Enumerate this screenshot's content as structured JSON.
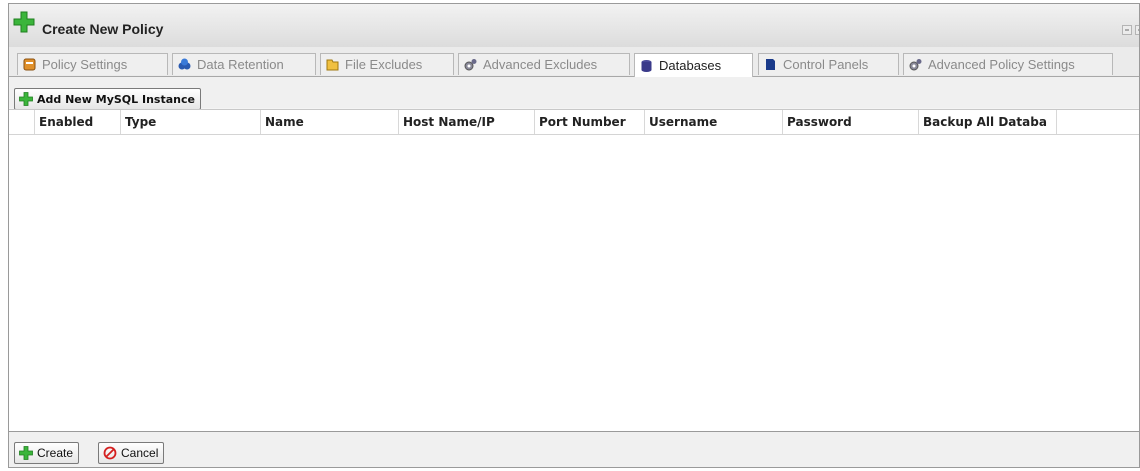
{
  "window": {
    "title": "Create New Policy"
  },
  "tabs": [
    {
      "label": "Policy Settings",
      "icon": "policy-settings-icon",
      "active": false
    },
    {
      "label": "Data Retention",
      "icon": "data-retention-icon",
      "active": false
    },
    {
      "label": "File Excludes",
      "icon": "file-excludes-icon",
      "active": false
    },
    {
      "label": "Advanced Excludes",
      "icon": "advanced-excludes-icon",
      "active": false
    },
    {
      "label": "Databases",
      "icon": "databases-icon",
      "active": true
    },
    {
      "label": "Control Panels",
      "icon": "control-panels-icon",
      "active": false
    },
    {
      "label": "Advanced Policy Settings",
      "icon": "advanced-policy-settings-icon",
      "active": false
    }
  ],
  "toolbar": {
    "add_label": "Add New MySQL Instance"
  },
  "grid": {
    "columns": [
      "Enabled",
      "Type",
      "Name",
      "Host Name/IP",
      "Port Number",
      "Username",
      "Password",
      "Backup All Databa"
    ],
    "rows": []
  },
  "footer": {
    "create_label": "Create",
    "cancel_label": "Cancel"
  },
  "colors": {
    "plus_green": "#3bb53b",
    "cancel_red": "#d42020",
    "active_tab": "#ffffff"
  }
}
